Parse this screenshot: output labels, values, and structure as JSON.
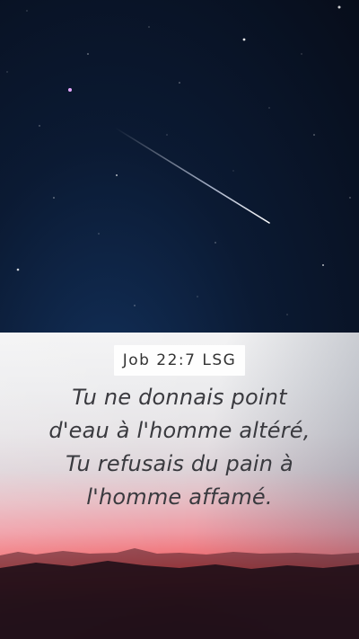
{
  "verse": {
    "reference": "Job 22:7 LSG",
    "lines": [
      "Tu ne donnais point",
      "d'eau à l'homme altéré,",
      "Tu refusais du pain à",
      "l'homme affamé."
    ]
  },
  "colors": {
    "night_sky": "#070d1a",
    "sunset_red": "#ea4a48",
    "text": "#3a3a3f"
  }
}
